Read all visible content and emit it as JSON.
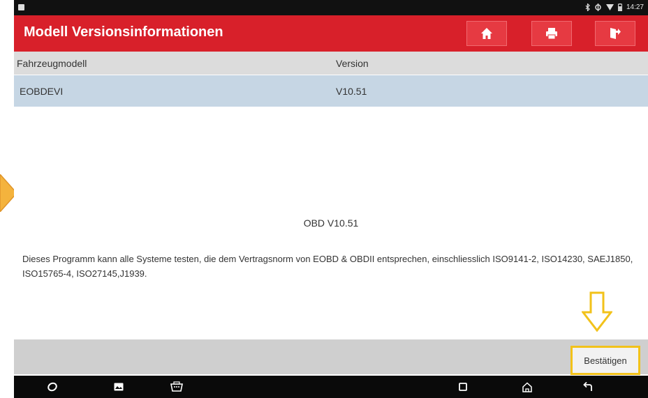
{
  "status_bar": {
    "time": "14:27",
    "icons": [
      "app-notification-icon",
      "bluetooth-icon",
      "sync-icon",
      "wifi-icon",
      "battery-icon"
    ]
  },
  "header": {
    "title": "Modell Versionsinformationen",
    "buttons": [
      {
        "name": "home-icon"
      },
      {
        "name": "print-icon"
      },
      {
        "name": "exit-icon"
      }
    ],
    "colors": {
      "bar": "#d8202a",
      "button": "#e63a42"
    }
  },
  "table": {
    "columns": [
      "Fahrzeugmodell",
      "Version"
    ],
    "rows": [
      {
        "model": "EOBDEVI",
        "version": "V10.51"
      }
    ]
  },
  "info": {
    "title": "OBD V10.51",
    "description": "Dieses Programm kann alle Systeme testen, die dem Vertragsnorm von EOBD & OBDII entsprechen,  einschliesslich ISO9141-2, ISO14230,  SAEJ1850, ISO15765-4, ISO27145,J1939."
  },
  "footer": {
    "confirm_label": "Bestätigen",
    "highlight_color": "#f2c21a"
  },
  "nav_bar": {
    "buttons": [
      "browser-icon",
      "gallery-icon",
      "vci-icon",
      "recent-apps-icon",
      "home-nav-icon",
      "back-icon"
    ]
  }
}
